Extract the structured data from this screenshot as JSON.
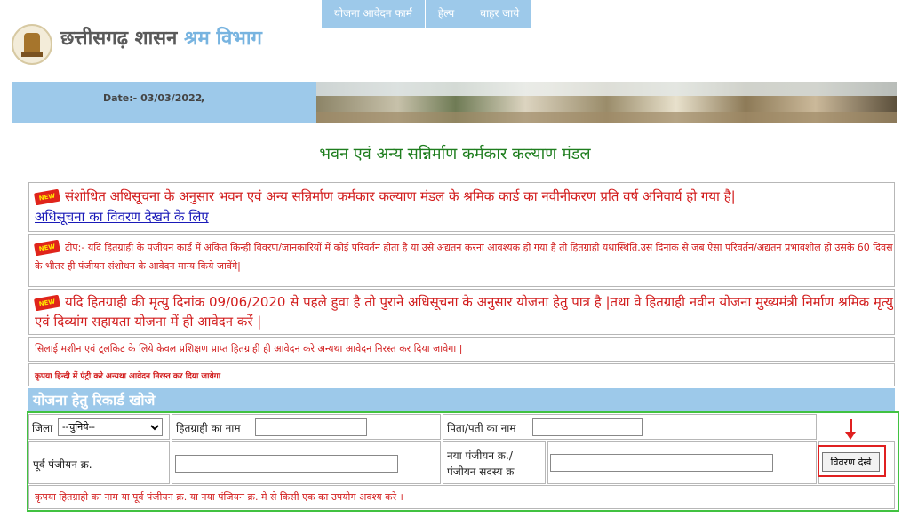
{
  "nav": {
    "items": [
      {
        "label": "योजना आवेदन फार्म"
      },
      {
        "label": "हेल्प"
      },
      {
        "label": "बाहर जाये"
      }
    ]
  },
  "header": {
    "title_part1": "छत्तीसगढ़ शासन",
    "title_part2": "श्रम विभाग"
  },
  "banner": {
    "date_text": "Date:- 03/03/2022",
    "separator": ","
  },
  "board_title": "भवन एवं अन्य सन्निर्माण कर्मकार कल्याण मंडल",
  "new_badge_label": "NEW",
  "notices": {
    "n1_text": "संशोधित अधिसूचना के अनुसार भवन एवं अन्य सन्निर्माण कर्मकार कल्याण मंडल के श्रमिक कार्ड का नवीनीकरण प्रति वर्ष अनिवार्य हो गया है|",
    "n1_link": "अधिसूचना का विवरण देखने के लिए",
    "n2_text": "टीप:- यदि हितग्राही के पंजीयन कार्ड में अंकित किन्ही विवरण/जानकारियों में कोई परिवर्तन होता है या उसे अद्यतन करना आवश्यक हो गया है तो हितग्राही यथास्थिति.उस दिनांक से जब ऐसा परिवर्तन/अद्यतन प्रभावशील हो उसके 60 दिवस के भीतर ही पंजीयन संशोधन के आवेदन मान्य किये जावेंगे|",
    "n3_text": "यदि हितग्राही की मृत्यु दिनांक 09/06/2020 से पहले हुवा है तो पुराने अधिसूचना के अनुसार योजना हेतु पात्र है |तथा वे हितग्राही नवीन योजना मुख्यमंत्री निर्माण श्रमिक मृत्यु एवं दिव्यांग सहायता योजना में ही आवेदन करें |",
    "n4_text": "सिलाई मशीन एवं टूलकिट के लिये केवल प्रशिक्षण प्राप्त हितग्राही ही आवेदन करे अन्यथा आवेदन निरस्त कर दिया जावेगा |",
    "n5_text": "कृपया हिन्दी में एंट्री करे अन्यथा आवेदन निरस्त कर दिया जायेगा"
  },
  "search": {
    "heading": "योजना हेतु रिकार्ड खोजे",
    "district_label": "जिला",
    "district_selected": "--चुनिये--",
    "beneficiary_name_label": "हितग्राही का नाम",
    "beneficiary_name_value": "",
    "father_husband_label": "पिता/पती का नाम",
    "father_husband_value": "",
    "old_reg_label": "पूर्व पंजीयन क्र.",
    "old_reg_value": "",
    "new_reg_label_1": "नया पंजीयन क्र./",
    "new_reg_label_2": "पंजीयन सदस्य क्र",
    "new_reg_value": "",
    "view_button": "विवरण देखे",
    "note": "कृपया हितग्राही का नाम या पूर्व पंजीयन क्र. या नया पंजियन क्र. मे से किसी एक का उपयोग अवश्य करे ।"
  },
  "colors": {
    "nav_bg": "#9dc9ea",
    "title_gray": "#5a5a5a",
    "title_blue": "#78b4e0",
    "heading_green": "#1e7d1e",
    "notice_red": "#d21d1d",
    "link_blue": "#1a1ab8",
    "highlight_green": "#41c241",
    "highlight_red": "#e02020"
  },
  "icons": {
    "logo": "chhattisgarh-emblem",
    "new_badge": "new-badge-icon",
    "arrow": "arrow-down-icon"
  }
}
